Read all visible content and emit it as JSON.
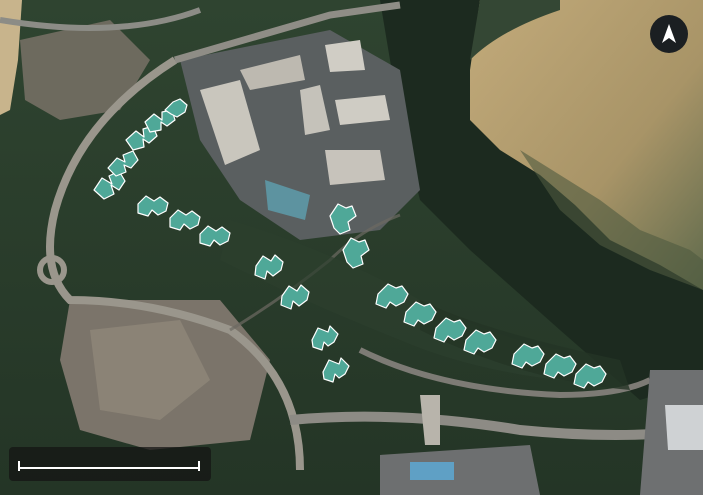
{
  "map": {
    "type": "satellite",
    "highlight_color": "#4fa898",
    "highlight_outline": "#ffffff"
  },
  "controls": {
    "north_arrow_icon": "north-arrow-icon",
    "scale_bar_label": ""
  }
}
